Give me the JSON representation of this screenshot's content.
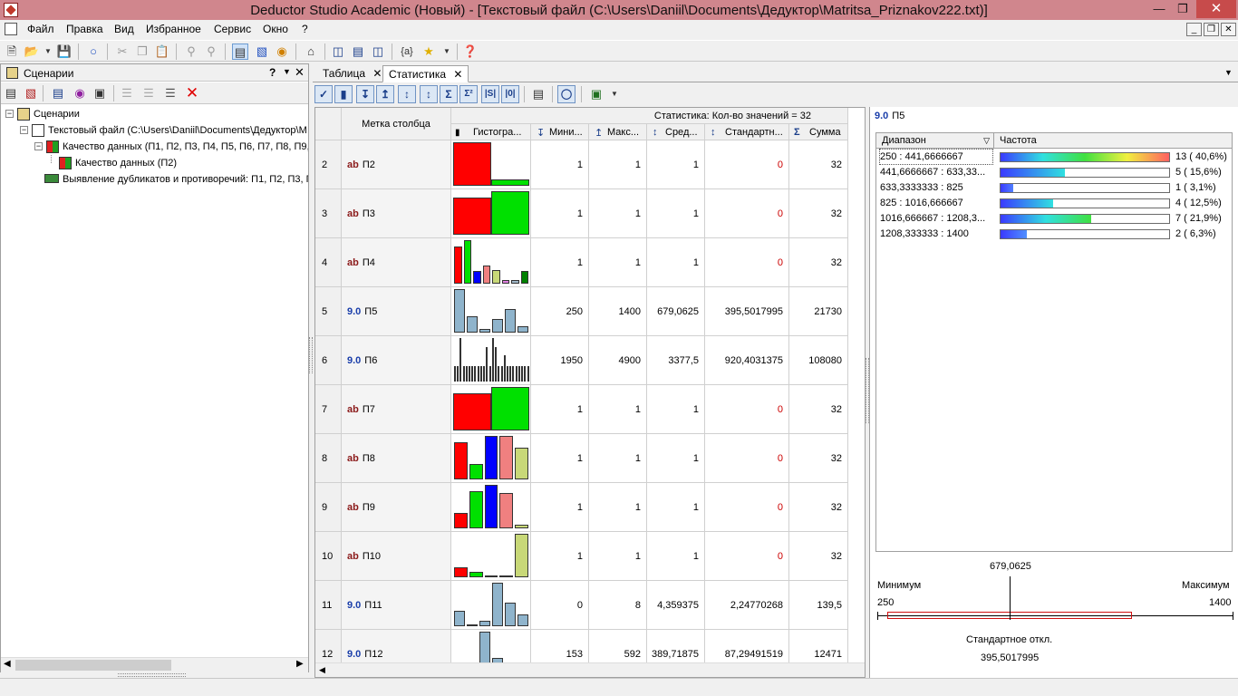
{
  "window": {
    "title": "Deductor Studio Academic (Новый) - [Текстовый файл (C:\\Users\\Daniil\\Documents\\Дедуктор\\Matritsa_Priznakov222.txt)]"
  },
  "menu": {
    "items": [
      "Файл",
      "Правка",
      "Вид",
      "Избранное",
      "Сервис",
      "Окно",
      "?"
    ]
  },
  "left_panel": {
    "title": "Сценарии",
    "tree": [
      {
        "label": "Сценарии",
        "level": 0,
        "icon": "scenarios-icon"
      },
      {
        "label": "Текстовый файл (C:\\Users\\Daniil\\Documents\\Дедуктор\\M",
        "level": 1,
        "icon": "text-file-icon"
      },
      {
        "label": "Качество данных (П1, П2, П3, П4, П5, П6, П7, П8, П9,",
        "level": 2,
        "icon": "data-quality-icon"
      },
      {
        "label": "Качество данных (П2)",
        "level": 3,
        "icon": "data-quality-icon"
      },
      {
        "label": "Выявление дубликатов и противоречий: П1, П2, П3, П",
        "level": 2,
        "icon": "duplicates-icon"
      }
    ]
  },
  "tabs": [
    {
      "label": "Таблица",
      "active": false
    },
    {
      "label": "Статистика",
      "active": true
    }
  ],
  "grid": {
    "stat_caption": "Статистика: Кол-во значений = 32",
    "label_header": "Метка столбца",
    "columns": [
      "Гистогра...",
      "Мини...",
      "Макс...",
      "Сред...",
      "Стандартн...",
      "Сумма"
    ],
    "rows": [
      {
        "n": "2",
        "type": "ab",
        "name": "П2",
        "min": "1",
        "max": "1",
        "mean": "1",
        "std": "0",
        "sum": "32",
        "hist": {
          "colors": [
            "#ff0000",
            "#00e000"
          ],
          "values": [
            1.0,
            0.15
          ],
          "outlined": true
        }
      },
      {
        "n": "3",
        "type": "ab",
        "name": "П3",
        "min": "1",
        "max": "1",
        "mean": "1",
        "std": "0",
        "sum": "32",
        "hist": {
          "colors": [
            "#ff0000",
            "#00e000"
          ],
          "values": [
            0.85,
            1.0
          ],
          "outlined": true
        }
      },
      {
        "n": "4",
        "type": "ab",
        "name": "П4",
        "min": "1",
        "max": "1",
        "mean": "1",
        "std": "0",
        "sum": "32",
        "hist": {
          "colors": [
            "#ff0000",
            "#00e000",
            "#0000ff",
            "#f08080",
            "#c8d878",
            "#e080e0",
            "#a0b8c8",
            "#008000"
          ],
          "values": [
            0.85,
            1.0,
            0.3,
            0.42,
            0.32,
            0.08,
            0.08,
            0.3
          ],
          "outlined": false
        }
      },
      {
        "n": "5",
        "type": "9.0",
        "name": "П5",
        "min": "250",
        "max": "1400",
        "mean": "679,0625",
        "std": "395,5017995",
        "sum": "21730",
        "hist": {
          "colors": [
            "#8fb4cc"
          ],
          "values": [
            1.0,
            0.38,
            0.08,
            0.31,
            0.54,
            0.15
          ],
          "outlined": false
        }
      },
      {
        "n": "6",
        "type": "9.0",
        "name": "П6",
        "min": "1950",
        "max": "4900",
        "mean": "3377,5",
        "std": "920,4031375",
        "sum": "108080",
        "hist": {
          "colors": [
            "#000080",
            "#206020",
            "#808020"
          ],
          "values": [
            0.35,
            0.35,
            1.0,
            0.35,
            0.35,
            0.35,
            0.35,
            0.35,
            0.35,
            0.35,
            0.35,
            0.8,
            0.35,
            1.0,
            0.8,
            0.35,
            0.35,
            0.6,
            0.35,
            0.35,
            0.35,
            0.35,
            0.35,
            0.35,
            0.35,
            0.35
          ],
          "outlined": false,
          "thin": true
        }
      },
      {
        "n": "7",
        "type": "ab",
        "name": "П7",
        "min": "1",
        "max": "1",
        "mean": "1",
        "std": "0",
        "sum": "32",
        "hist": {
          "colors": [
            "#ff0000",
            "#00e000"
          ],
          "values": [
            0.85,
            1.0
          ],
          "outlined": true
        }
      },
      {
        "n": "8",
        "type": "ab",
        "name": "П8",
        "min": "1",
        "max": "1",
        "mean": "1",
        "std": "0",
        "sum": "32",
        "hist": {
          "colors": [
            "#ff0000",
            "#00e000",
            "#0000ff",
            "#f08080",
            "#c8d878"
          ],
          "values": [
            0.85,
            0.35,
            1.0,
            1.0,
            0.72
          ],
          "outlined": false
        }
      },
      {
        "n": "9",
        "type": "ab",
        "name": "П9",
        "min": "1",
        "max": "1",
        "mean": "1",
        "std": "0",
        "sum": "32",
        "hist": {
          "colors": [
            "#ff0000",
            "#00e000",
            "#0000ff",
            "#f08080",
            "#c8d878"
          ],
          "values": [
            0.35,
            0.85,
            1.0,
            0.82,
            0.08
          ],
          "outlined": false
        }
      },
      {
        "n": "10",
        "type": "ab",
        "name": "П10",
        "min": "1",
        "max": "1",
        "mean": "1",
        "std": "0",
        "sum": "32",
        "hist": {
          "colors": [
            "#ff0000",
            "#00e000",
            "#0000ff",
            "#f08080",
            "#c8d878"
          ],
          "values": [
            0.22,
            0.12,
            0.04,
            0.04,
            1.0
          ],
          "outlined": false
        }
      },
      {
        "n": "11",
        "type": "9.0",
        "name": "П11",
        "min": "0",
        "max": "8",
        "mean": "4,359375",
        "std": "2,24770268",
        "sum": "139,5",
        "hist": {
          "colors": [
            "#8fb4cc"
          ],
          "values": [
            0.35,
            0.0,
            0.12,
            1.0,
            0.55,
            0.27
          ],
          "outlined": false
        }
      },
      {
        "n": "12",
        "type": "9.0",
        "name": "П12",
        "min": "153",
        "max": "592",
        "mean": "389,71875",
        "std": "87,29491519",
        "sum": "12471",
        "hist": {
          "colors": [
            "#8fb4cc"
          ],
          "values": [
            0.0,
            0.0,
            1.0,
            0.4,
            0.0,
            0.0
          ],
          "outlined": false
        }
      }
    ]
  },
  "detail": {
    "type": "9.0",
    "name": "П5",
    "columns": [
      "Диапазон",
      "Частота"
    ],
    "rows": [
      {
        "range": "250 : 441,6666667",
        "label": "13 ( 40,6%)",
        "fraction": 1.0,
        "gradient": "linear-gradient(to right,#3a3aff,#30e0e0,#40e040,#f0f040,#ff6060)"
      },
      {
        "range": "441,6666667 : 633,33...",
        "label": "5 ( 15,6%)",
        "fraction": 0.38,
        "gradient": "linear-gradient(to right,#3a3aff,#30e0e0)"
      },
      {
        "range": "633,3333333 : 825",
        "label": "1 (  3,1%)",
        "fraction": 0.077,
        "gradient": "linear-gradient(to right,#3a3aff,#5080ff)"
      },
      {
        "range": "825 : 1016,666667",
        "label": "4 ( 12,5%)",
        "fraction": 0.31,
        "gradient": "linear-gradient(to right,#3a3aff,#30e0e0)"
      },
      {
        "range": "1016,666667 : 1208,3...",
        "label": "7 ( 21,9%)",
        "fraction": 0.54,
        "gradient": "linear-gradient(to right,#3a3aff,#30e0e0,#40e040)"
      },
      {
        "range": "1208,333333 : 1400",
        "label": "2 (  6,3%)",
        "fraction": 0.154,
        "gradient": "linear-gradient(to right,#3a3aff,#5090ff)"
      }
    ],
    "summary": {
      "mean": 679.0625,
      "mean_label": "679,0625",
      "min_caption": "Минимум",
      "max_caption": "Максимум",
      "min_label": "250",
      "max_label": "1400",
      "min": 250,
      "max": 1400,
      "std_low": 283.56,
      "std_high": 1074.56,
      "std_caption": "Стандартное откл.",
      "std_label": "395,5017995"
    }
  },
  "colors": {
    "titlebar": "#d0868d",
    "close": "#c74b4b",
    "zero_value": "#cc0000"
  }
}
